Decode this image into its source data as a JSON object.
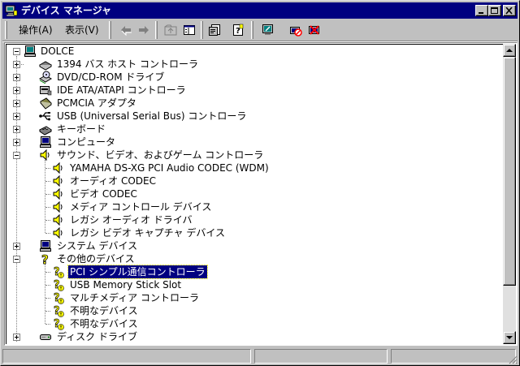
{
  "window": {
    "title": "デバイス マネージャ",
    "title_icon": "device-manager-icon",
    "colors": {
      "titlebar": "#000080",
      "face": "#c0c0c0",
      "selection": "#000080"
    }
  },
  "menu": [
    {
      "label": "操作(A)",
      "underline": "A"
    },
    {
      "label": "表示(V)",
      "underline": "V"
    }
  ],
  "toolbar": [
    {
      "name": "back-button",
      "icon": "arrow-left-icon",
      "enabled": false
    },
    {
      "name": "forward-button",
      "icon": "arrow-right-icon",
      "enabled": false
    },
    {
      "name": "up-button",
      "icon": "folder-up-icon",
      "enabled": false
    },
    {
      "name": "show-hide-tree-button",
      "icon": "tree-pane-icon",
      "enabled": true
    },
    {
      "name": "properties-button",
      "icon": "properties-icon",
      "enabled": true
    },
    {
      "name": "help-button",
      "icon": "help-icon",
      "enabled": true
    },
    {
      "name": "scan-hardware-button",
      "icon": "scan-hardware-icon",
      "enabled": true
    },
    {
      "name": "disable-device-button",
      "icon": "disable-device-icon",
      "enabled": true
    },
    {
      "name": "uninstall-device-button",
      "icon": "uninstall-device-icon",
      "enabled": true
    }
  ],
  "tree": [
    {
      "label": "DOLCE",
      "level": 0,
      "state": "expanded",
      "icon": "computer-icon"
    },
    {
      "label": "1394 バス ホスト コントローラ",
      "level": 1,
      "state": "collapsed",
      "icon": "bus-host-icon"
    },
    {
      "label": "DVD/CD-ROM ドライブ",
      "level": 1,
      "state": "collapsed",
      "icon": "cdrom-icon"
    },
    {
      "label": "IDE ATA/ATAPI コントローラ",
      "level": 1,
      "state": "collapsed",
      "icon": "ide-controller-icon"
    },
    {
      "label": "PCMCIA アダプタ",
      "level": 1,
      "state": "collapsed",
      "icon": "pcmcia-card-icon"
    },
    {
      "label": "USB (Universal Serial Bus) コントローラ",
      "level": 1,
      "state": "collapsed",
      "icon": "usb-icon"
    },
    {
      "label": "キーボード",
      "level": 1,
      "state": "collapsed",
      "icon": "keyboard-icon"
    },
    {
      "label": "コンピュータ",
      "level": 1,
      "state": "collapsed",
      "icon": "computer-icon"
    },
    {
      "label": "サウンド、ビデオ、およびゲーム コントローラ",
      "level": 1,
      "state": "expanded",
      "icon": "speaker-icon"
    },
    {
      "label": "YAMAHA DS-XG PCI Audio CODEC (WDM)",
      "level": 2,
      "icon": "speaker-icon"
    },
    {
      "label": "オーディオ CODEC",
      "level": 2,
      "icon": "speaker-icon"
    },
    {
      "label": "ビデオ CODEC",
      "level": 2,
      "icon": "speaker-icon"
    },
    {
      "label": "メディア コントロール デバイス",
      "level": 2,
      "icon": "speaker-icon"
    },
    {
      "label": "レガシ オーディオ ドライバ",
      "level": 2,
      "icon": "speaker-icon"
    },
    {
      "label": "レガシ ビデオ キャプチャ デバイス",
      "level": 2,
      "icon": "speaker-icon"
    },
    {
      "label": "システム デバイス",
      "level": 1,
      "state": "collapsed",
      "icon": "system-device-icon"
    },
    {
      "label": "その他のデバイス",
      "level": 1,
      "state": "expanded",
      "icon": "question-mark-icon"
    },
    {
      "label": "PCI シンプル通信コントローラ",
      "level": 2,
      "icon": "unknown-device-warning-icon",
      "selected": true
    },
    {
      "label": "USB Memory Stick Slot",
      "level": 2,
      "icon": "unknown-device-warning-icon"
    },
    {
      "label": "マルチメディア コントローラ",
      "level": 2,
      "icon": "unknown-device-warning-icon"
    },
    {
      "label": "不明なデバイス",
      "level": 2,
      "icon": "unknown-device-warning-icon"
    },
    {
      "label": "不明なデバイス",
      "level": 2,
      "icon": "unknown-device-warning-icon"
    },
    {
      "label": "ディスク ドライブ",
      "level": 1,
      "state": "collapsed",
      "icon": "disk-drive-icon"
    }
  ],
  "statusbar": {
    "panes": [
      "",
      "",
      ""
    ]
  }
}
